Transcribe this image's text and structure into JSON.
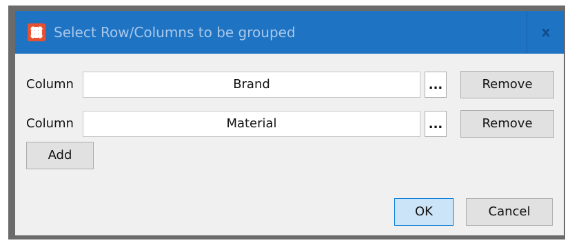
{
  "window": {
    "title": "Select Row/Columns to be grouped",
    "close_glyph": "x",
    "icon": "app-grid-icon",
    "title_bar_color": "#1f73c3"
  },
  "rows": [
    {
      "label": "Column",
      "value": "Brand",
      "browse_label": "...",
      "remove_label": "Remove"
    },
    {
      "label": "Column",
      "value": "Material",
      "browse_label": "...",
      "remove_label": "Remove"
    }
  ],
  "buttons": {
    "add_label": "Add",
    "ok_label": "OK",
    "cancel_label": "Cancel"
  }
}
